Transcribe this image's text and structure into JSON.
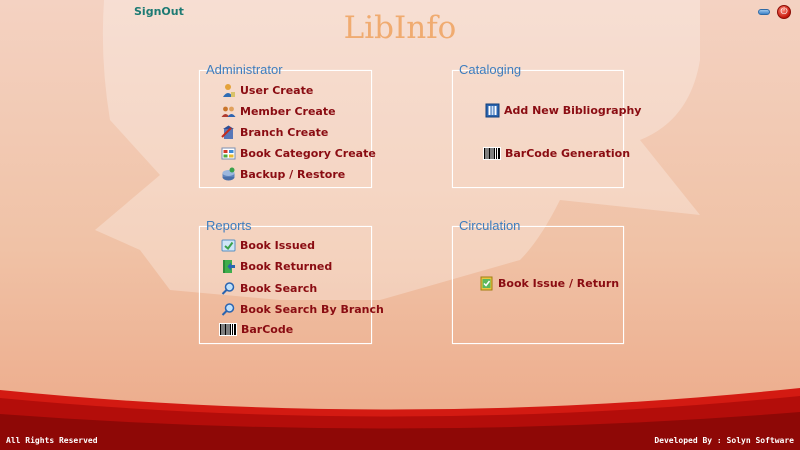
{
  "header": {
    "signout_label": "SignOut",
    "app_title": "LibInfo",
    "minimize_icon": "minimize-icon",
    "close_icon": "close-icon"
  },
  "panels": {
    "administrator": {
      "title": "Administrator",
      "items": [
        {
          "label": "User Create",
          "icon": "user-icon"
        },
        {
          "label": "Member Create",
          "icon": "members-icon"
        },
        {
          "label": "Branch Create",
          "icon": "branch-icon"
        },
        {
          "label": "Book Category Create",
          "icon": "category-icon"
        },
        {
          "label": "Backup / Restore",
          "icon": "backup-icon"
        }
      ]
    },
    "cataloging": {
      "title": "Cataloging",
      "items": [
        {
          "label": "Add New Bibliography",
          "icon": "bibliography-icon"
        },
        {
          "label": "BarCode Generation",
          "icon": "barcode-icon"
        }
      ]
    },
    "reports": {
      "title": "Reports",
      "items": [
        {
          "label": "Book Issued",
          "icon": "book-issued-icon"
        },
        {
          "label": "Book Returned",
          "icon": "book-returned-icon"
        },
        {
          "label": "Book Search",
          "icon": "search-icon"
        },
        {
          "label": "Book Search By Branch",
          "icon": "search-icon"
        },
        {
          "label": "BarCode",
          "icon": "barcode-icon"
        }
      ]
    },
    "circulation": {
      "title": "Circulation",
      "items": [
        {
          "label": "Book Issue / Return",
          "icon": "book-issue-return-icon"
        }
      ]
    }
  },
  "footer": {
    "rights": "All Rights Reserved",
    "developer": "Developed By : Solyn Software"
  },
  "colors": {
    "panel_title": "#3e7dbe",
    "menu_text": "#8a0c12",
    "signout": "#1d7a73",
    "app_title": "#f0ab70",
    "footer_band": "#c4120e"
  }
}
